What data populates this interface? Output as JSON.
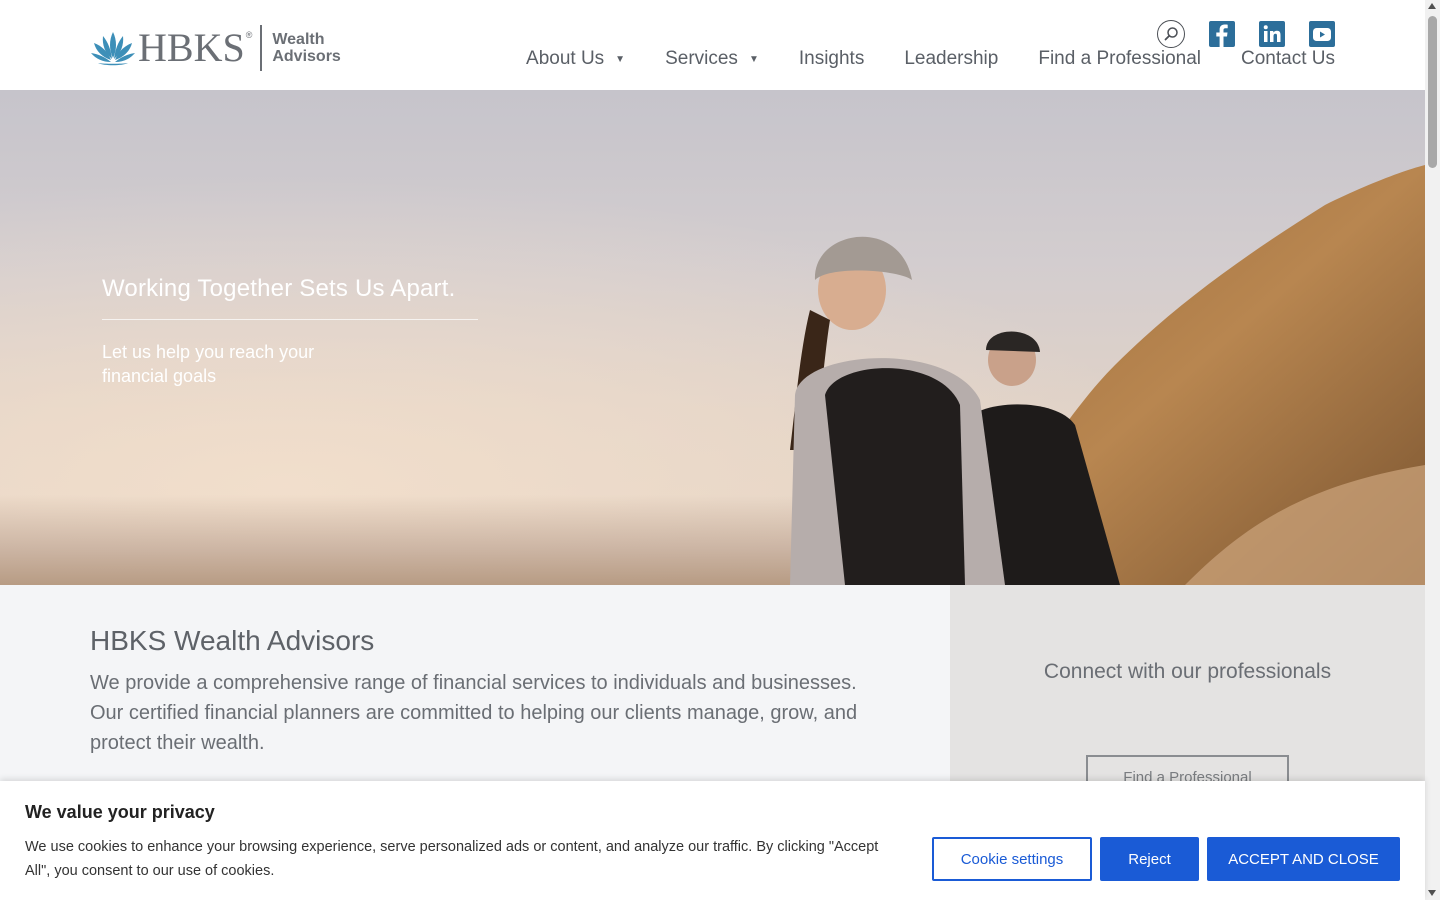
{
  "header": {
    "logo": {
      "brand": "HBKS",
      "reg": "®",
      "sub_line1": "Wealth",
      "sub_line2": "Advisors"
    },
    "icons": [
      "search-icon",
      "facebook-icon",
      "linkedin-icon",
      "youtube-icon"
    ],
    "nav": [
      {
        "label": "About Us",
        "has_dropdown": true
      },
      {
        "label": "Services",
        "has_dropdown": true
      },
      {
        "label": "Insights",
        "has_dropdown": false
      },
      {
        "label": "Leadership",
        "has_dropdown": false
      },
      {
        "label": "Find a Professional",
        "has_dropdown": false
      },
      {
        "label": "Contact Us",
        "has_dropdown": false
      }
    ]
  },
  "hero": {
    "title": "Working Together Sets Us Apart.",
    "subtitle": "Let us help you reach your financial goals"
  },
  "main": {
    "heading": "HBKS Wealth Advisors",
    "body": "We provide a comprehensive range of financial services to individuals and businesses. Our certified financial planners are committed to helping our clients manage, grow, and protect their wealth."
  },
  "sidebar": {
    "title": "Connect with our professionals",
    "button": "Find a Professional"
  },
  "cookie_banner": {
    "title": "We value your privacy",
    "text": "We use cookies to enhance your browsing experience, serve personalized ads or content, and analyze our traffic. By clicking \"Accept All\", you consent to our use of cookies.",
    "settings_label": "Cookie settings",
    "reject_label": "Reject",
    "accept_label": "ACCEPT AND CLOSE"
  },
  "colors": {
    "accent_blue": "#1a5bd6",
    "logo_teal": "#3d8fb8",
    "text_gray": "#5c6066",
    "social_blue": "#2c6e9a"
  }
}
